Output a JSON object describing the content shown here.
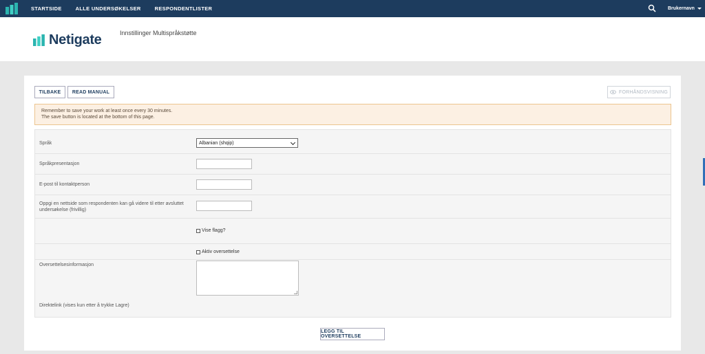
{
  "nav": {
    "items": [
      "STARTSIDE",
      "ALLE UNDERSØKELSER",
      "RESPONDENTLISTER"
    ],
    "user_label": "Brukernavn"
  },
  "header": {
    "brand_name": "Netigate",
    "page_title": "Innstillinger Multispråkstøtte"
  },
  "toolbar": {
    "back_label": "TILBAKE",
    "manual_label": "READ MANUAL",
    "preview_label": "FORHÅNDSVISNING"
  },
  "alert": {
    "line1": "Remember to save your work at least once every 30 minutes.",
    "line2": "The save button is located at the bottom of this page."
  },
  "form": {
    "language_label": "Språk",
    "language_value": "Albanian (shqip)",
    "presentation_label": "Språkpresentasjon",
    "email_label": "E-post til kontaktperson",
    "website_label": "Oppgi en nettside som respondenten kan gå videre til etter avsluttet undersøkelse (frivillig)",
    "show_flag_label": "Vise flagg?",
    "active_label": "Aktiv oversettelse",
    "info_label": "Oversettelsesinformasjon",
    "direct_link_label": "Direktelink (vises kun etter å trykke Lagre)"
  },
  "footer": {
    "add_label": "LEGG TIL OVERSETTELSE"
  },
  "colors": {
    "nav_bg": "#1d3c5e",
    "brand_teal": "#2bb5b0",
    "alert_bg": "#fcf0e3",
    "alert_border": "#ecc48e"
  }
}
